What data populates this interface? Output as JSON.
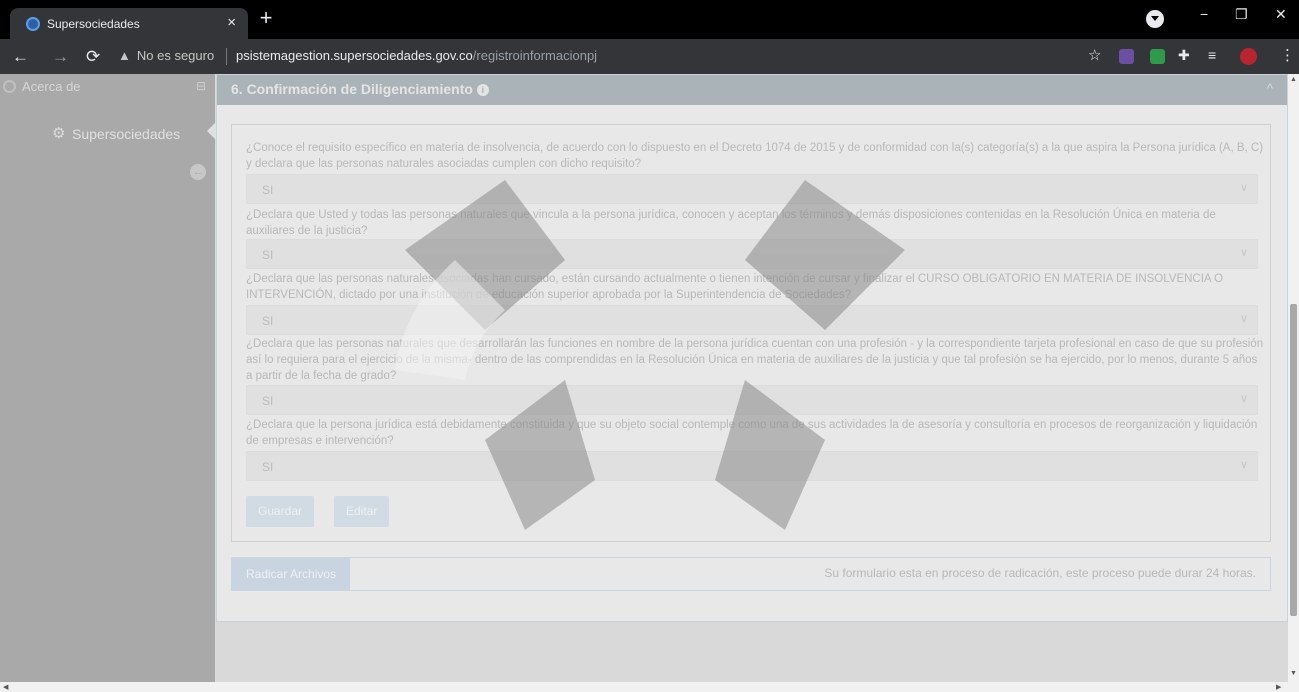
{
  "browser": {
    "tab_title": "Supersociedades",
    "tab_close": "×",
    "new_tab": "+",
    "window_controls": [
      "−",
      "❐",
      "✕"
    ],
    "security_label": "No es seguro",
    "url_host": "psistemagestion.supersociedades.gov.co",
    "url_path": "/registroinformacionpj",
    "icons": [
      "back-icon",
      "forward-icon",
      "reload-icon",
      "warning-icon",
      "star-icon",
      "extension-icons",
      "puzzle-icon",
      "queue-icon",
      "avatar-icon",
      "menu-icon"
    ]
  },
  "sidebar": {
    "about_label": "Acerca de",
    "item_label": "Supersociedades"
  },
  "section": {
    "title": "6. Confirmación de Diligenciamiento",
    "info_glyph": "i"
  },
  "questions": [
    {
      "text": "¿Conoce el requisito específico en materia de insolvencia, de acuerdo con lo dispuesto en el Decreto 1074 de 2015 y de conformidad con la(s) categoría(s) a la que aspira la Persona jurídica (A, B, C) y declara que las personas naturales asociadas cumplen con dicho requisito?",
      "answer": "SI"
    },
    {
      "text": "¿Declara que Usted y todas las personas naturales que vincula a la persona jurídica, conocen y aceptan los términos y demás disposiciones contenidas en la Resolución Única en materia de auxiliares de la justicia?",
      "answer": "SI"
    },
    {
      "text": "¿Declara que las personas naturales asociadas han cursado, están cursando actualmente o tienen intención de cursar y finalizar el CURSO OBLIGATORIO EN MATERIA DE INSOLVENCIA O INTERVENCIÓN, dictado por una institución de educación superior aprobada por la Superintendencia de Sociedades?",
      "answer": "SI"
    },
    {
      "text": "¿Declara que las personas naturales que desarrollarán las funciones en nombre de la persona jurídica cuentan con una profesión - y la correspondiente tarjeta profesional en caso de que su profesión así lo requiera para el ejercicio de la misma- dentro de las comprendidas en la Resolución Única en materia de auxiliares de la justicia y que tal profesión se ha ejercido, por lo menos, durante 5 años a partir de la fecha de grado?",
      "answer": "SI"
    },
    {
      "text": "¿Declara que la persona jurídica está debidamente constituida y que su objeto social contemple como una de sus actividades la de asesoría y consultoría en procesos de reorganización y liquidación de empresas e intervención?",
      "answer": "SI"
    }
  ],
  "actions": {
    "save_label": "Guardar",
    "edit_label": "Editar"
  },
  "radicar": {
    "button_label": "Radicar Archivos",
    "message": "Su formulario esta en proceso de radicación, este proceso puede durar 24 horas."
  },
  "colors": {
    "sidebar": "#a9a9a9",
    "panel_header": "#aab3b8",
    "watermark": "#8a8a8a"
  }
}
